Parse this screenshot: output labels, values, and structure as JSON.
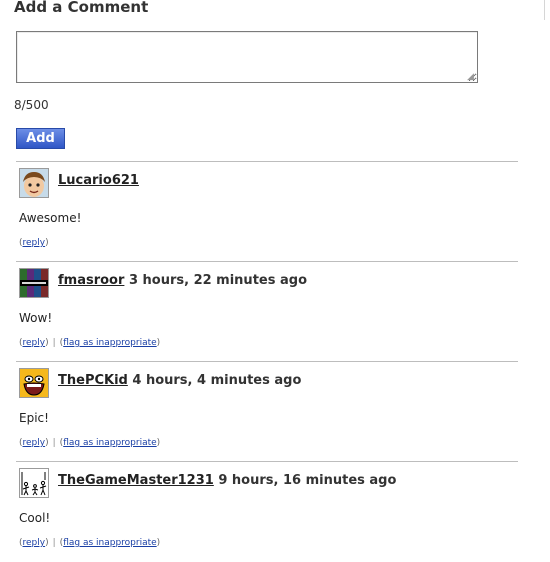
{
  "form": {
    "title": "Add a Comment",
    "textarea_value": "",
    "counter": "8/500",
    "add_label": "Add"
  },
  "comments": [
    {
      "user": "Lucario621",
      "time": "",
      "text": "Awesome!",
      "reply": "reply",
      "flag": ""
    },
    {
      "user": "fmasroor",
      "time": "3 hours, 22 minutes ago",
      "text": "Wow!",
      "reply": "reply",
      "flag": "flag as inappropriate"
    },
    {
      "user": "ThePCKid",
      "time": "4 hours, 4 minutes ago",
      "text": "Epic!",
      "reply": "reply",
      "flag": "flag as inappropriate"
    },
    {
      "user": "TheGameMaster1231",
      "time": "9 hours, 16 minutes ago",
      "text": "Cool!",
      "reply": "reply",
      "flag": "flag as inappropriate"
    }
  ],
  "icons": {
    "avatar_1": "mii-face-avatar",
    "avatar_2": "colorful-text-avatar",
    "avatar_3": "yellow-laughing-face-avatar",
    "avatar_4": "stick-figures-avatar"
  }
}
